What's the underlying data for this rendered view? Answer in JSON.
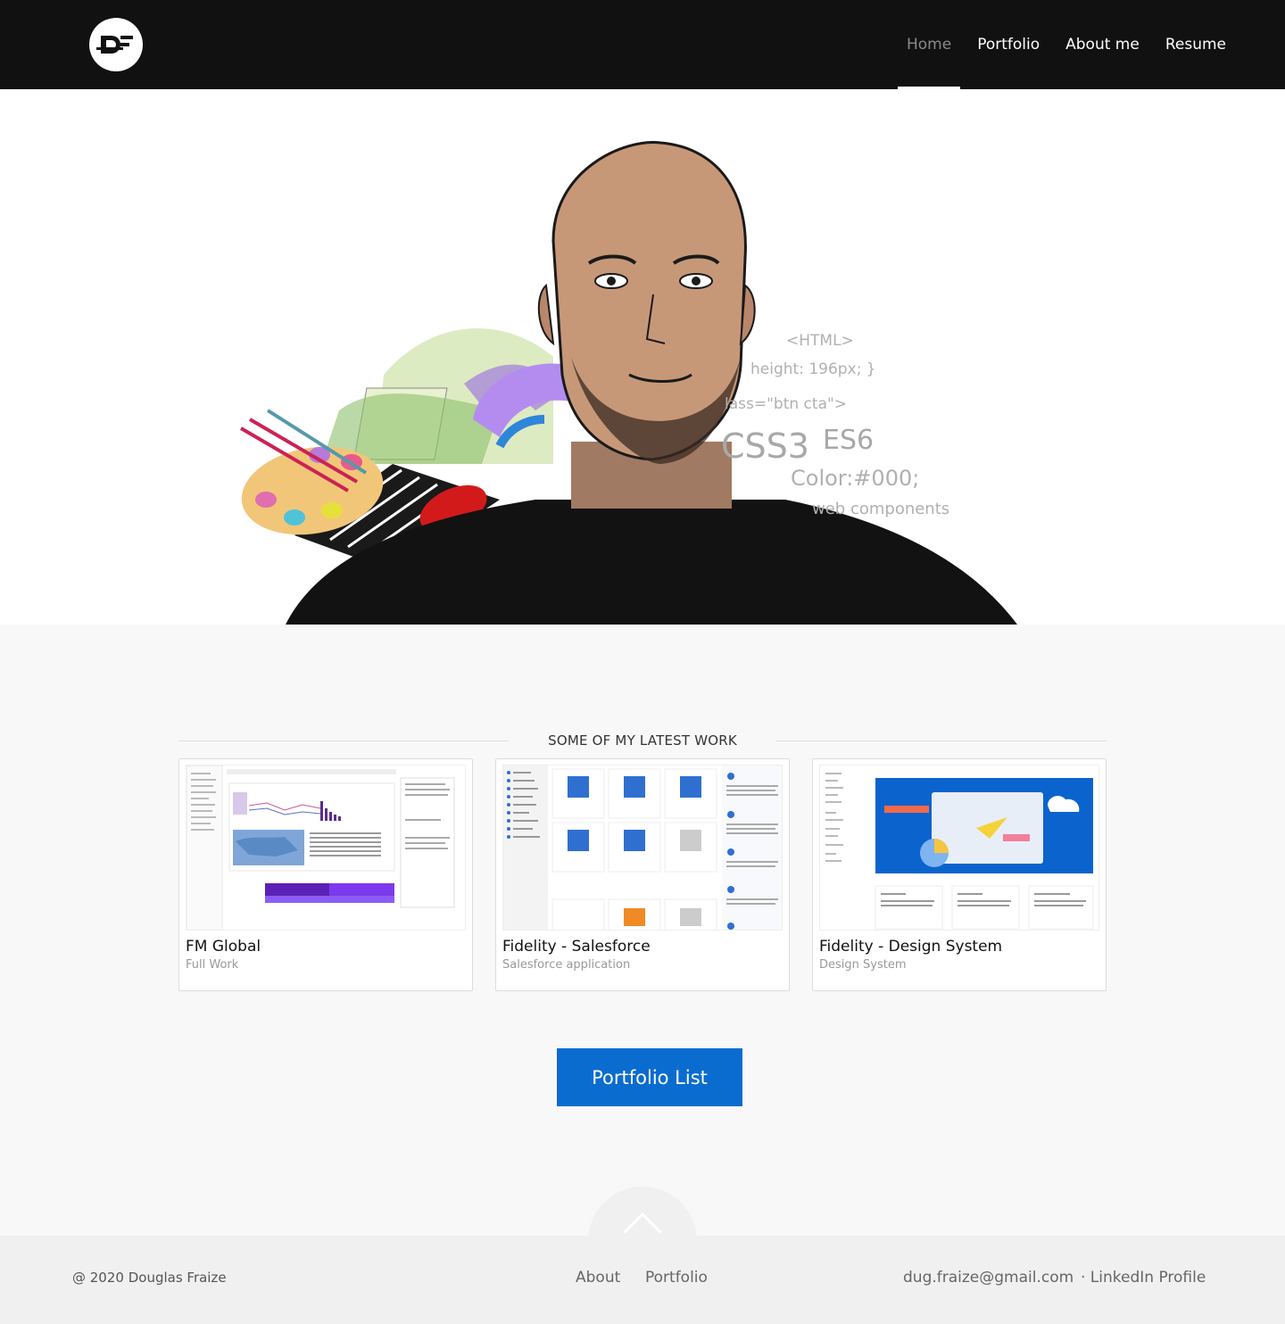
{
  "header": {
    "logo_text": "DF",
    "nav": [
      {
        "label": "Home",
        "active": true
      },
      {
        "label": "Portfolio",
        "active": false
      },
      {
        "label": "About me",
        "active": false
      },
      {
        "label": "Resume",
        "active": false
      }
    ]
  },
  "hero": {
    "code_snippets": [
      "<HTML>",
      "height: 196px; }",
      "lass=\"btn cta\">",
      "CSS3",
      "ES6",
      "Color:#000;",
      "web components"
    ]
  },
  "work": {
    "section_title": "SOME OF MY LATEST WORK",
    "cards": [
      {
        "title": "FM Global",
        "subtitle": "Full Work"
      },
      {
        "title": "Fidelity - Salesforce",
        "subtitle": "Salesforce application"
      },
      {
        "title": "Fidelity - Design System",
        "subtitle": "Design System"
      }
    ],
    "button_label": "Portfolio List"
  },
  "footer": {
    "copyright": "@ 2020 Douglas Fraize",
    "links": {
      "about": "About",
      "portfolio": "Portfolio",
      "email": "dug.fraize@gmail.com",
      "linkedin": "· LinkedIn Profile"
    }
  },
  "colors": {
    "header_bg": "#111111",
    "accent_button": "#0a6ccf",
    "page_bg": "#f8f8f8",
    "footer_bg": "#f0f0f0"
  }
}
